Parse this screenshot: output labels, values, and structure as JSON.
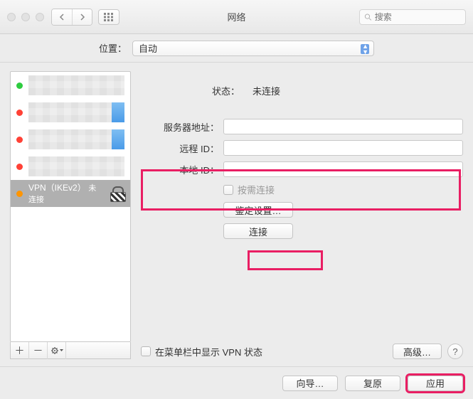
{
  "window": {
    "title": "网络"
  },
  "toolbar": {
    "search_placeholder": "搜索"
  },
  "location": {
    "label": "位置：",
    "value": "自动"
  },
  "sidebar": {
    "items": [
      {
        "status": "green"
      },
      {
        "status": "red"
      },
      {
        "status": "red"
      },
      {
        "status": "red"
      },
      {
        "status": "orange",
        "name": "VPN（IKEv2）",
        "sub": "未连接",
        "selected": true,
        "locked": true
      }
    ]
  },
  "status": {
    "label": "状态：",
    "value": "未连接"
  },
  "fields": {
    "server_label": "服务器地址：",
    "server_value": "",
    "remote_label": "远程 ID：",
    "remote_value": "",
    "local_label": "本地 ID：",
    "local_value": ""
  },
  "ondemand": {
    "label": "按需连接"
  },
  "buttons": {
    "auth": "鉴定设置…",
    "connect": "连接",
    "advanced": "高级…",
    "showmenu_label": "在菜单栏中显示 VPN 状态",
    "wizard": "向导…",
    "revert": "复原",
    "apply": "应用"
  }
}
